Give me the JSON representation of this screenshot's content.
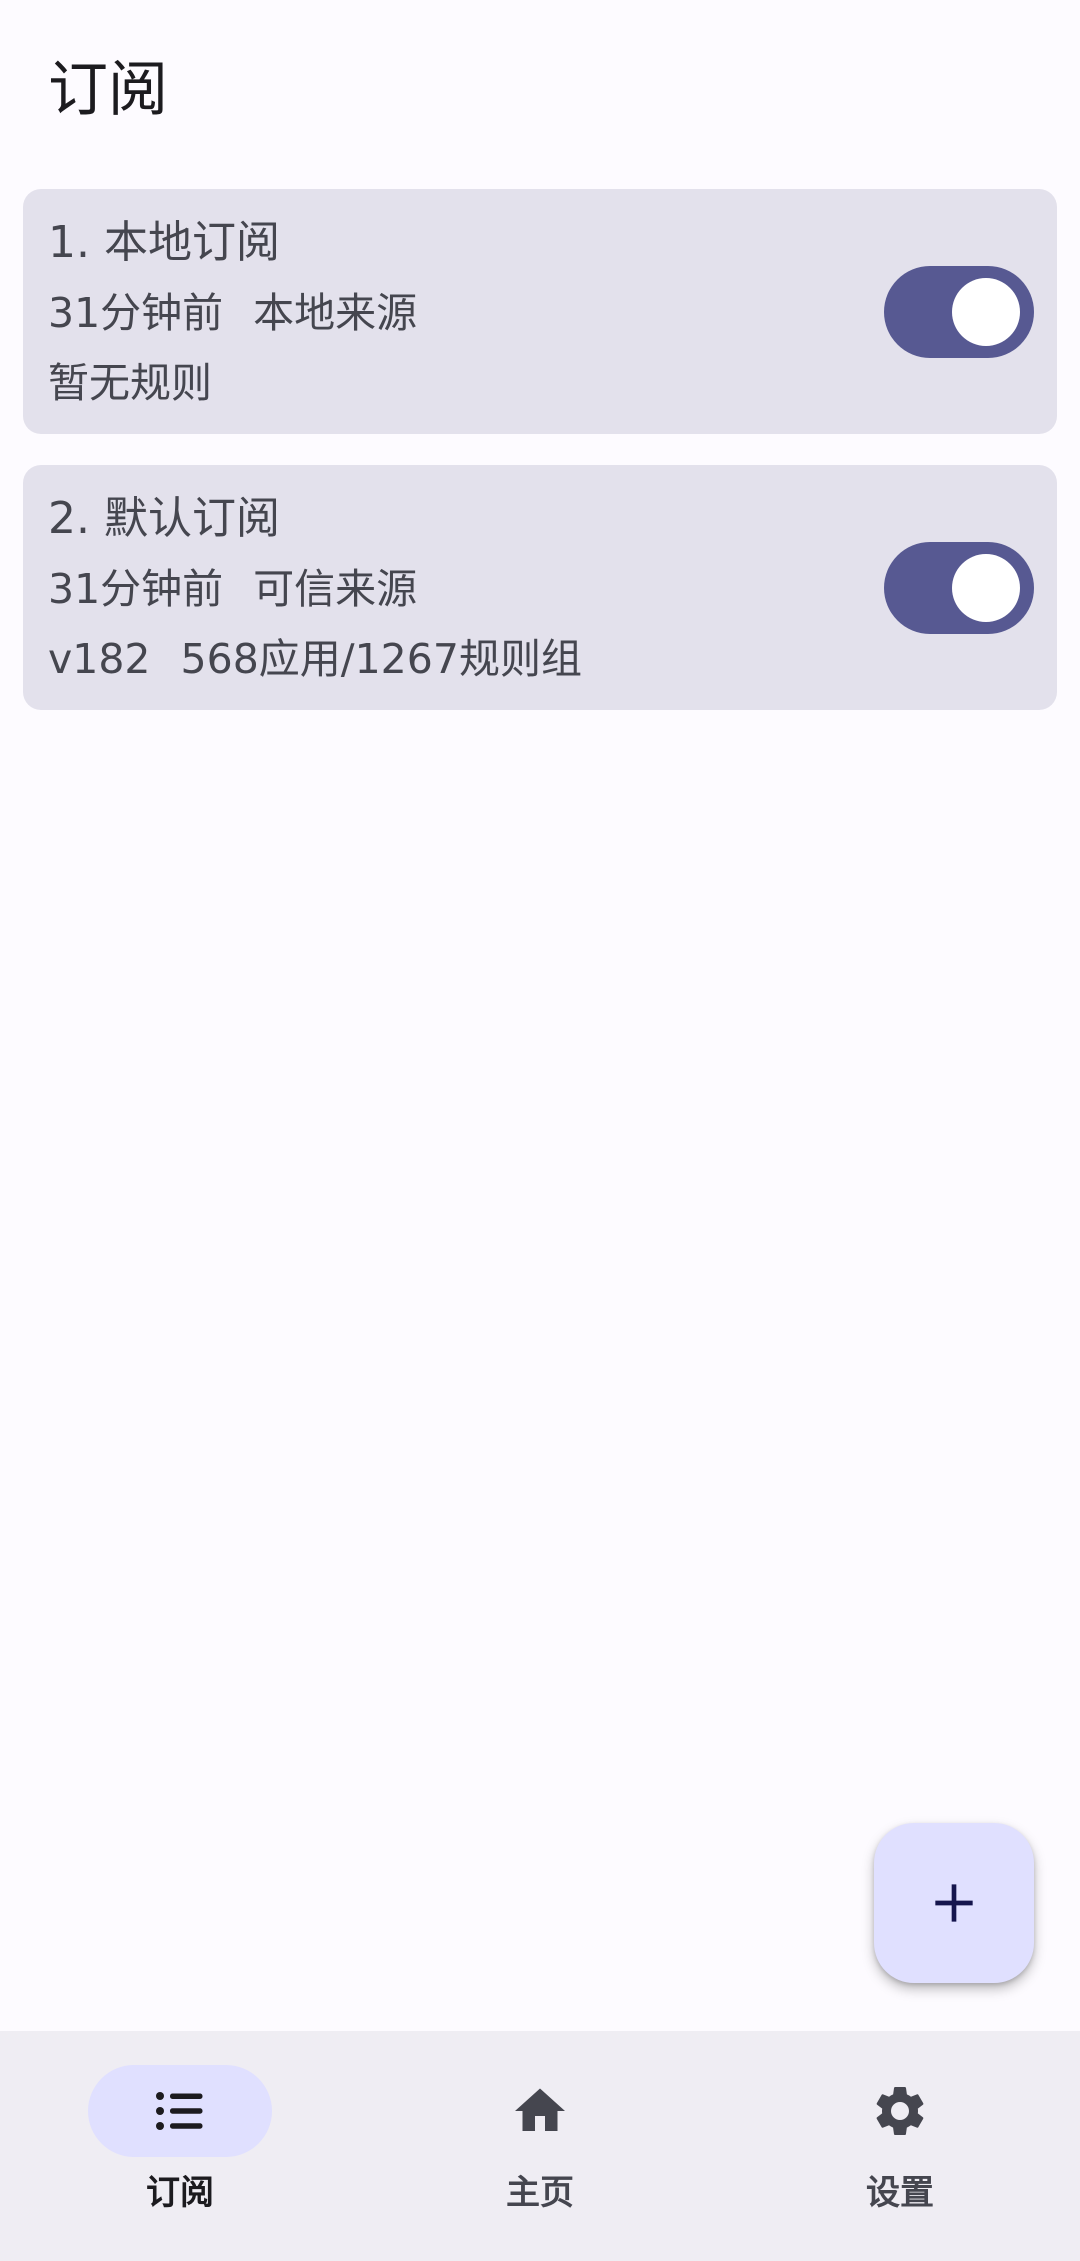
{
  "header": {
    "title": "订阅"
  },
  "subscriptions": [
    {
      "title": "1. 本地订阅",
      "time": "31分钟前",
      "source": "本地来源",
      "info": "暂无规则",
      "enabled": true
    },
    {
      "title": "2. 默认订阅",
      "time": "31分钟前",
      "source": "可信来源",
      "version": "v182",
      "stats": "568应用/1267规则组",
      "enabled": true
    }
  ],
  "fab": {
    "icon": "plus-icon"
  },
  "bottom_nav": {
    "items": [
      {
        "label": "订阅",
        "icon": "list-icon",
        "active": true
      },
      {
        "label": "主页",
        "icon": "home-icon",
        "active": false
      },
      {
        "label": "设置",
        "icon": "gear-icon",
        "active": false
      }
    ]
  },
  "colors": {
    "background": "#FDFBFF",
    "card": "#E3E1EC",
    "toggle_on": "#575992",
    "fab": "#E0E0FF",
    "nav_bar": "#EFEDF3",
    "nav_indicator": "#E0E0FF"
  }
}
